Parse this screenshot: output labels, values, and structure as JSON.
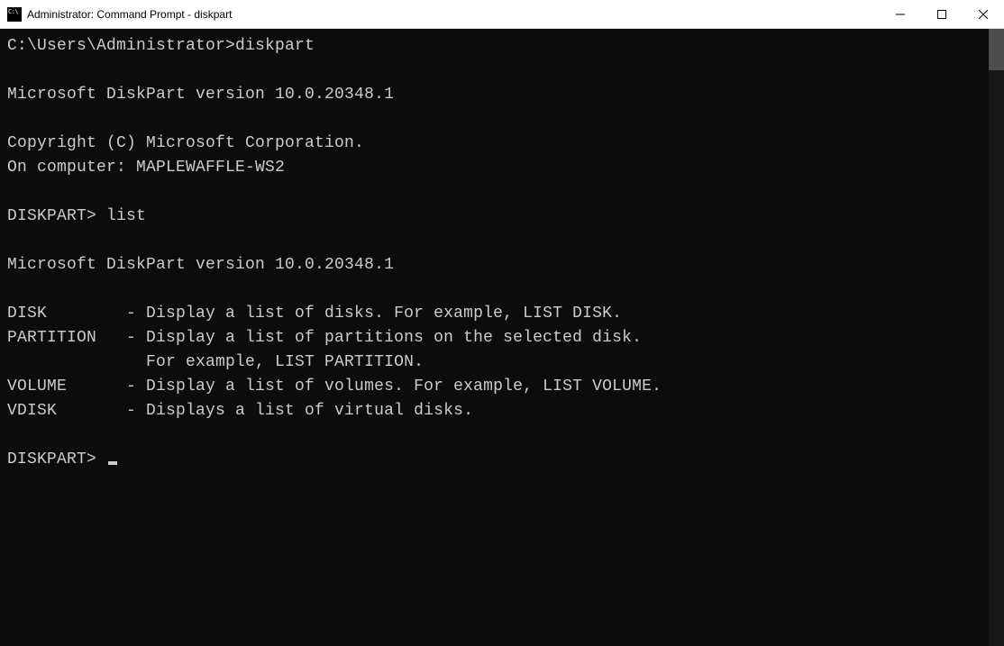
{
  "titlebar": {
    "title": "Administrator: Command Prompt - diskpart"
  },
  "console": {
    "prompt1": "C:\\Users\\Administrator>",
    "cmd1": "diskpart",
    "blank": "",
    "version1": "Microsoft DiskPart version 10.0.20348.1",
    "copyright": "Copyright (C) Microsoft Corporation.",
    "computer": "On computer: MAPLEWAFFLE-WS2",
    "prompt2": "DISKPART> ",
    "cmd2": "list",
    "version2": "Microsoft DiskPart version 10.0.20348.1",
    "help_disk": "DISK        - Display a list of disks. For example, LIST DISK.",
    "help_partition": "PARTITION   - Display a list of partitions on the selected disk.",
    "help_partition2": "              For example, LIST PARTITION.",
    "help_volume": "VOLUME      - Display a list of volumes. For example, LIST VOLUME.",
    "help_vdisk": "VDISK       - Displays a list of virtual disks.",
    "prompt3": "DISKPART> "
  }
}
